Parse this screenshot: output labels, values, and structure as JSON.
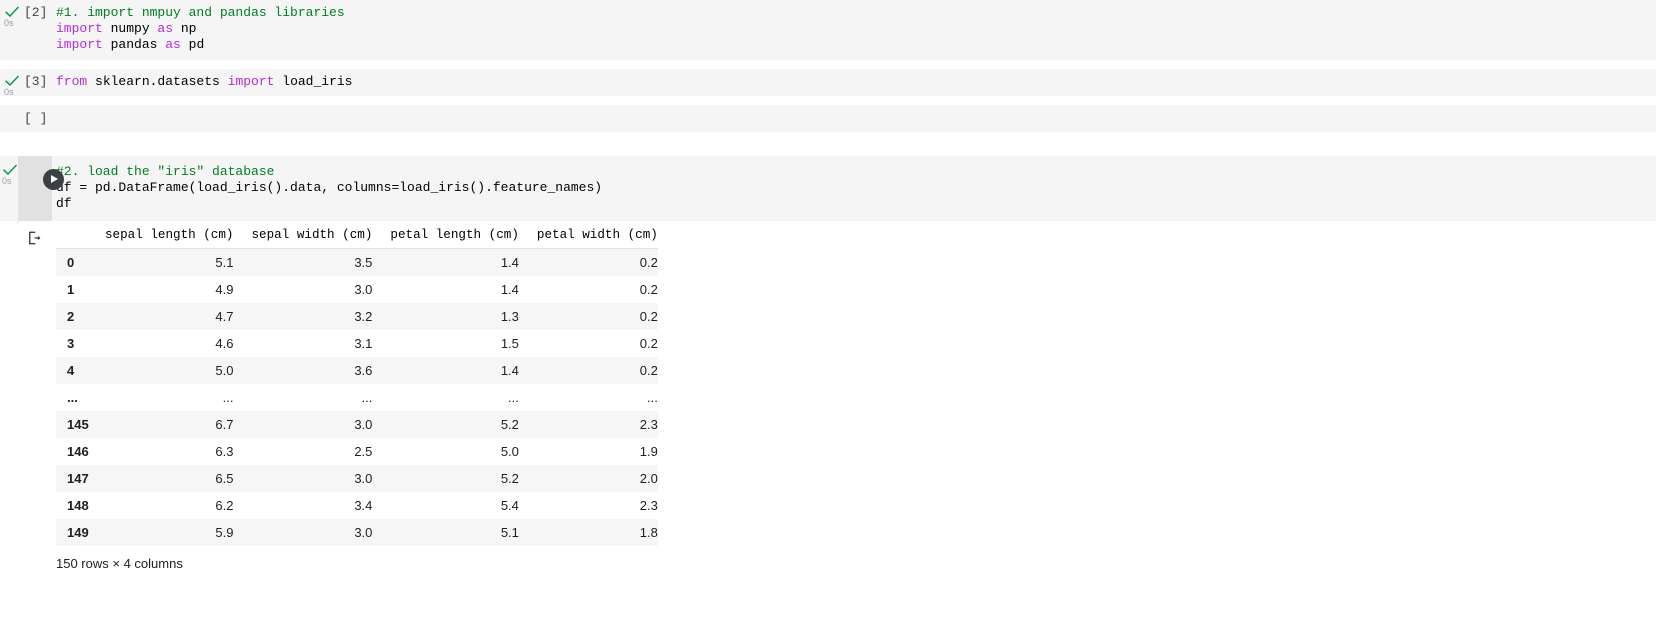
{
  "notebook": {
    "cells": [
      {
        "kind": "code",
        "exec_label": "[2]",
        "run_time": "0s",
        "status_icon": "check-icon",
        "lines": [
          [
            {
              "t": "comment",
              "s": "#1. import nmpuy and pandas libraries"
            }
          ],
          [
            {
              "t": "kw",
              "s": "import"
            },
            {
              "t": "plain",
              "s": " numpy "
            },
            {
              "t": "kw",
              "s": "as"
            },
            {
              "t": "plain",
              "s": " np"
            }
          ],
          [
            {
              "t": "kw",
              "s": "import"
            },
            {
              "t": "plain",
              "s": " pandas "
            },
            {
              "t": "kw",
              "s": "as"
            },
            {
              "t": "plain",
              "s": " pd"
            }
          ]
        ]
      },
      {
        "kind": "code",
        "exec_label": "[3]",
        "run_time": "0s",
        "status_icon": "check-icon",
        "lines": [
          [
            {
              "t": "kw",
              "s": "from"
            },
            {
              "t": "plain",
              "s": " sklearn.datasets "
            },
            {
              "t": "kw",
              "s": "import"
            },
            {
              "t": "plain",
              "s": " load_iris"
            }
          ]
        ]
      },
      {
        "kind": "empty",
        "exec_label": "[ ]",
        "run_time": "",
        "status_icon": "",
        "lines": []
      },
      {
        "kind": "active",
        "exec_label": "",
        "run_time": "0s",
        "status_icon": "check-icon",
        "run_button": "run-cell-button",
        "lines": [
          [
            {
              "t": "comment",
              "s": "#2. load the \"iris\" database"
            }
          ],
          [
            {
              "t": "plain",
              "s": "df = pd.DataFrame(load_iris().data, columns=load_iris().feature_names)"
            }
          ],
          [
            {
              "t": "plain",
              "s": "df"
            }
          ]
        ]
      }
    ]
  },
  "output": {
    "icon": "output-export-icon",
    "table": {
      "index_header": "",
      "columns": [
        "sepal length (cm)",
        "sepal width (cm)",
        "petal length (cm)",
        "petal width (cm)"
      ],
      "rows": [
        {
          "index": "0",
          "values": [
            "5.1",
            "3.5",
            "1.4",
            "0.2"
          ]
        },
        {
          "index": "1",
          "values": [
            "4.9",
            "3.0",
            "1.4",
            "0.2"
          ]
        },
        {
          "index": "2",
          "values": [
            "4.7",
            "3.2",
            "1.3",
            "0.2"
          ]
        },
        {
          "index": "3",
          "values": [
            "4.6",
            "3.1",
            "1.5",
            "0.2"
          ]
        },
        {
          "index": "4",
          "values": [
            "5.0",
            "3.6",
            "1.4",
            "0.2"
          ]
        },
        {
          "index": "...",
          "values": [
            "...",
            "...",
            "...",
            "..."
          ]
        },
        {
          "index": "145",
          "values": [
            "6.7",
            "3.0",
            "5.2",
            "2.3"
          ]
        },
        {
          "index": "146",
          "values": [
            "6.3",
            "2.5",
            "5.0",
            "1.9"
          ]
        },
        {
          "index": "147",
          "values": [
            "6.5",
            "3.0",
            "5.2",
            "2.0"
          ]
        },
        {
          "index": "148",
          "values": [
            "6.2",
            "3.4",
            "5.4",
            "2.3"
          ]
        },
        {
          "index": "149",
          "values": [
            "5.9",
            "3.0",
            "5.1",
            "1.8"
          ]
        }
      ],
      "footer": "150 rows × 4 columns"
    }
  },
  "colors": {
    "cell_background": "#f5f5f5",
    "page_background": "#ffffff",
    "comment": "#007f20",
    "keyword": "#b32fd6",
    "status_check": "#0f9d58",
    "run_button": "#3c4043",
    "stripe": "#f6f6f6"
  }
}
